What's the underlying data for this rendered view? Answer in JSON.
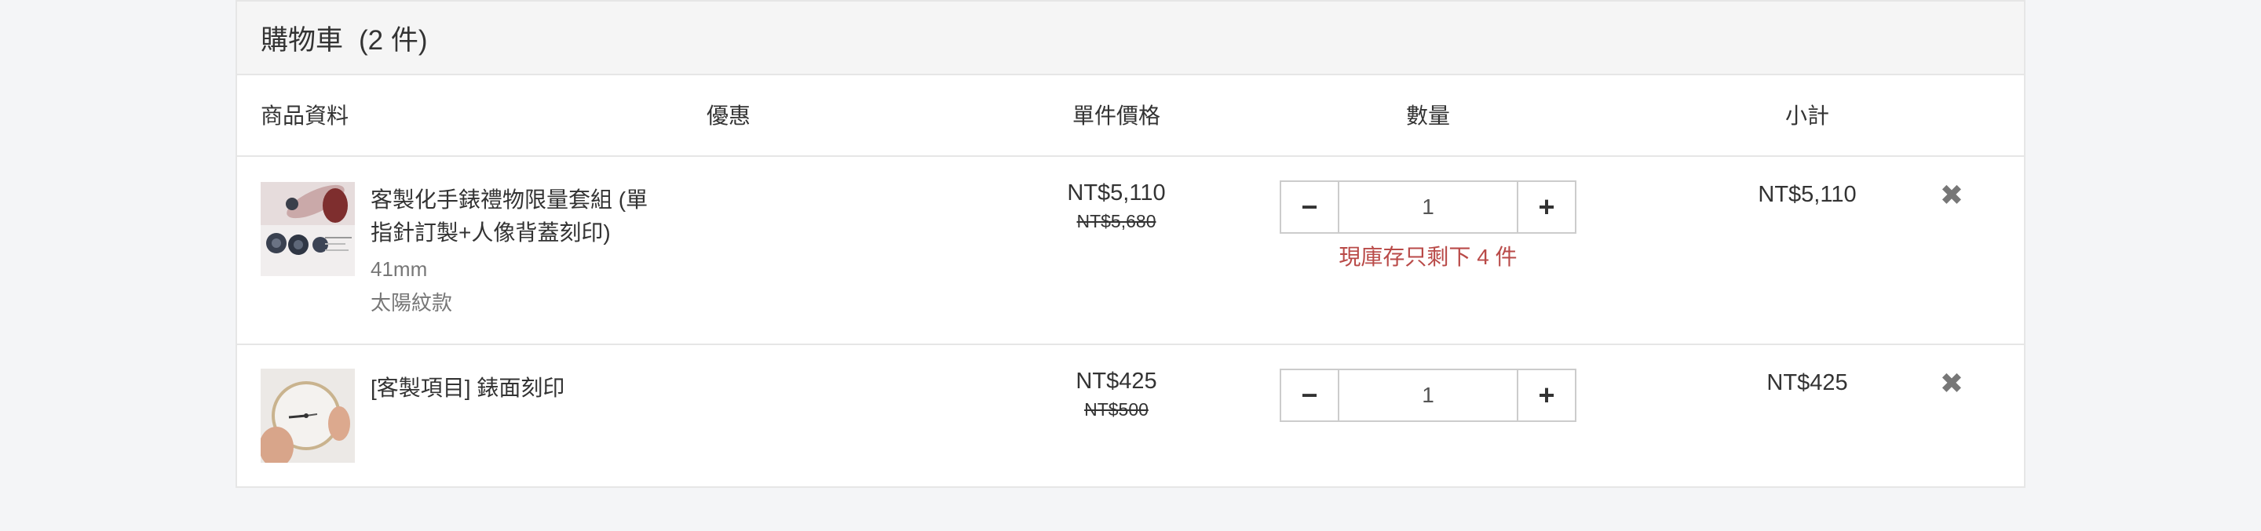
{
  "cart": {
    "title": "購物車",
    "count_label": "(2 件)"
  },
  "columns": {
    "product": "商品資料",
    "discount": "優惠",
    "unit_price": "單件價格",
    "quantity": "數量",
    "subtotal": "小計"
  },
  "items": [
    {
      "name": "客製化手錶禮物限量套組 (單指針訂製+人像背蓋刻印)",
      "variant_size": "41mm",
      "variant_style": "太陽紋款",
      "price": "NT$5,110",
      "original_price": "NT$5,680",
      "quantity": "1",
      "stock_note": "現庫存只剩下 4 件",
      "subtotal": "NT$5,110"
    },
    {
      "name": "[客製項目] 錶面刻印",
      "price": "NT$425",
      "original_price": "NT$500",
      "quantity": "1",
      "subtotal": "NT$425"
    }
  ],
  "icons": {
    "minus": "−",
    "plus": "+",
    "remove": "✖"
  },
  "colors": {
    "stock_warning": "#b94a48"
  }
}
